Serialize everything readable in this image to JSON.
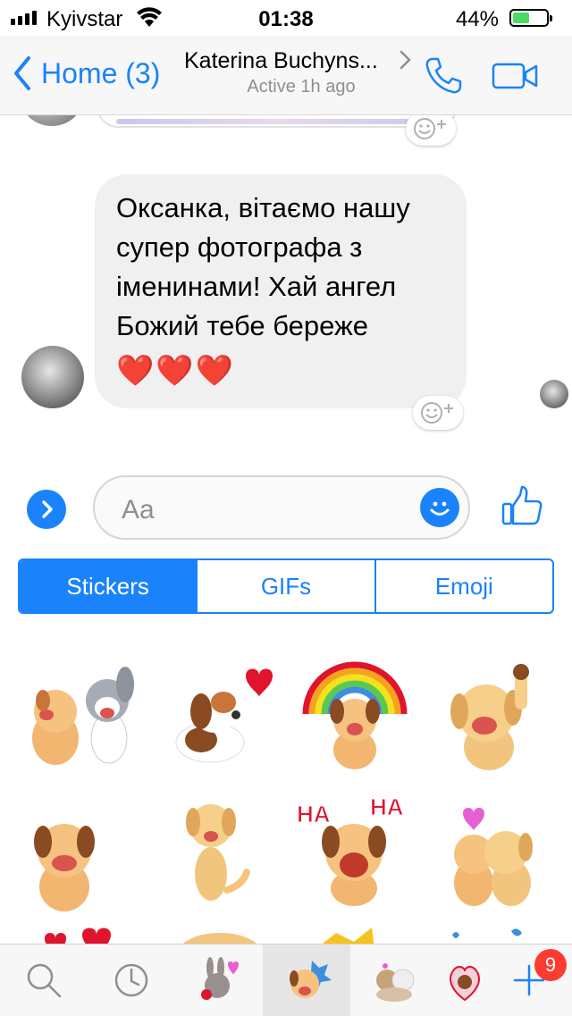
{
  "status_bar": {
    "carrier": "Kyivstar",
    "time": "01:38",
    "battery_percent": "44%",
    "battery_level": 0.44
  },
  "nav": {
    "back_label": "Home (3)",
    "contact_name": "Katerina Buchyns...",
    "contact_status": "Active 1h ago"
  },
  "message": {
    "text": "Оксанка, вітаємо нашу супер фотографа з іменинами! Хай ангел Божий тебе береже",
    "hearts": "❤️❤️❤️"
  },
  "composer": {
    "placeholder": "Aa"
  },
  "tabs": [
    {
      "label": "Stickers",
      "active": true
    },
    {
      "label": "GIFs",
      "active": false
    },
    {
      "label": "Emoji",
      "active": false
    }
  ],
  "stickers": [
    {
      "name": "two-dogs",
      "text": ""
    },
    {
      "name": "beagle-heart",
      "text": ""
    },
    {
      "name": "dog-rainbow",
      "text": ""
    },
    {
      "name": "dog-waving",
      "text": ""
    },
    {
      "name": "dog-laughing",
      "text": ""
    },
    {
      "name": "dog-dancing",
      "text": ""
    },
    {
      "name": "dog-haha",
      "text": "HA"
    },
    {
      "name": "dogs-kiss",
      "text": ""
    }
  ],
  "bottom_bar": {
    "badge_count": "9"
  },
  "colors": {
    "accent": "#1a82fb",
    "bubble": "#f1f0f0",
    "badge": "#fe3b30"
  }
}
